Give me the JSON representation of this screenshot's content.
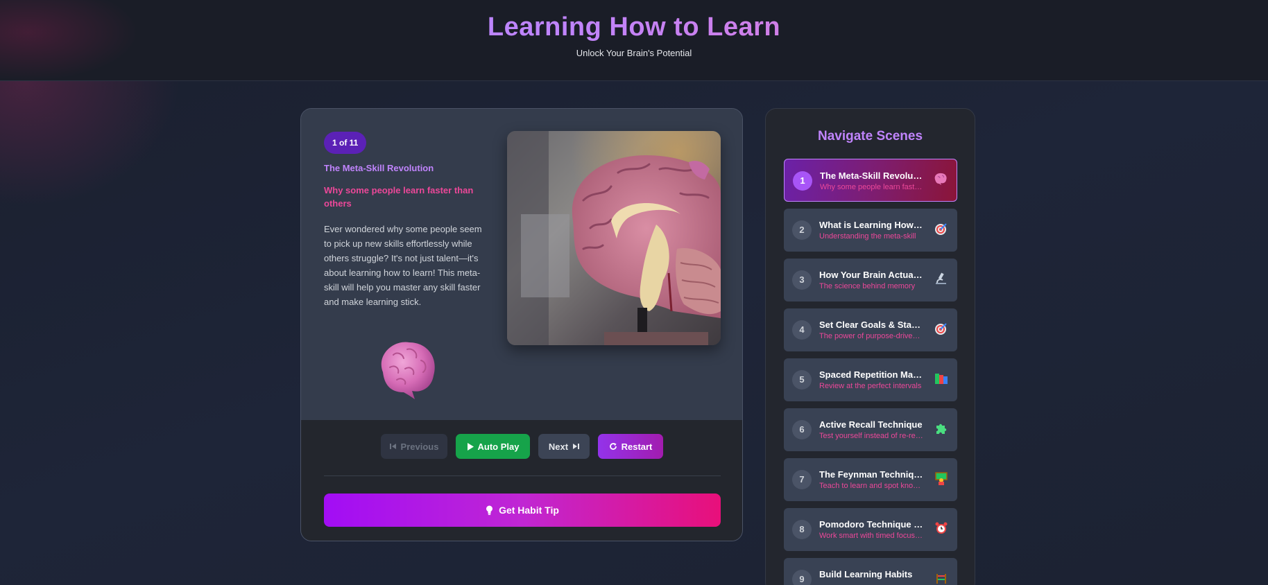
{
  "header": {
    "title": "Learning How to Learn",
    "subtitle": "Unlock Your Brain's Potential"
  },
  "scene": {
    "badge": "1 of 11",
    "title": "The Meta-Skill Revolution",
    "subtitle": "Why some people learn faster than others",
    "body": "Ever wondered why some people seem to pick up new skills effortlessly while others struggle? It's not just talent—it's about learning how to learn! This meta-skill will help you master any skill faster and make learning stick.",
    "emoji": "brain-icon",
    "image": "brain-model-photo"
  },
  "controls": {
    "previous": "Previous",
    "auto_play": "Auto Play",
    "next": "Next",
    "restart": "Restart",
    "habit_tip": "Get Habit Tip"
  },
  "sidebar": {
    "title": "Navigate Scenes",
    "items": [
      {
        "num": "1",
        "title": "The Meta-Skill Revolution",
        "sub": "Why some people learn faster than others",
        "icon": "brain-icon",
        "active": true
      },
      {
        "num": "2",
        "title": "What is Learning How to Learn?",
        "sub": "Understanding the meta-skill",
        "icon": "target-icon"
      },
      {
        "num": "3",
        "title": "How Your Brain Actually Learns",
        "sub": "The science behind memory",
        "icon": "microscope-icon"
      },
      {
        "num": "4",
        "title": "Set Clear Goals & Stay Focused",
        "sub": "The power of purpose-driven learning",
        "icon": "target-icon"
      },
      {
        "num": "5",
        "title": "Spaced Repetition Magic",
        "sub": "Review at the perfect intervals",
        "icon": "books-icon"
      },
      {
        "num": "6",
        "title": "Active Recall Technique",
        "sub": "Test yourself instead of re-reading",
        "icon": "puzzle-icon"
      },
      {
        "num": "7",
        "title": "The Feynman Technique",
        "sub": "Teach to learn and spot knowledge gaps",
        "icon": "teacher-icon"
      },
      {
        "num": "8",
        "title": "Pomodoro Technique for Focus",
        "sub": "Work smart with timed focus sessions",
        "icon": "alarm-clock-icon"
      },
      {
        "num": "9",
        "title": "Build Learning Habits",
        "sub": "",
        "icon": "habit-icon"
      }
    ]
  },
  "colors": {
    "accent_purple": "#c084fc",
    "accent_pink": "#ec4899",
    "play_green": "#16a34a"
  }
}
